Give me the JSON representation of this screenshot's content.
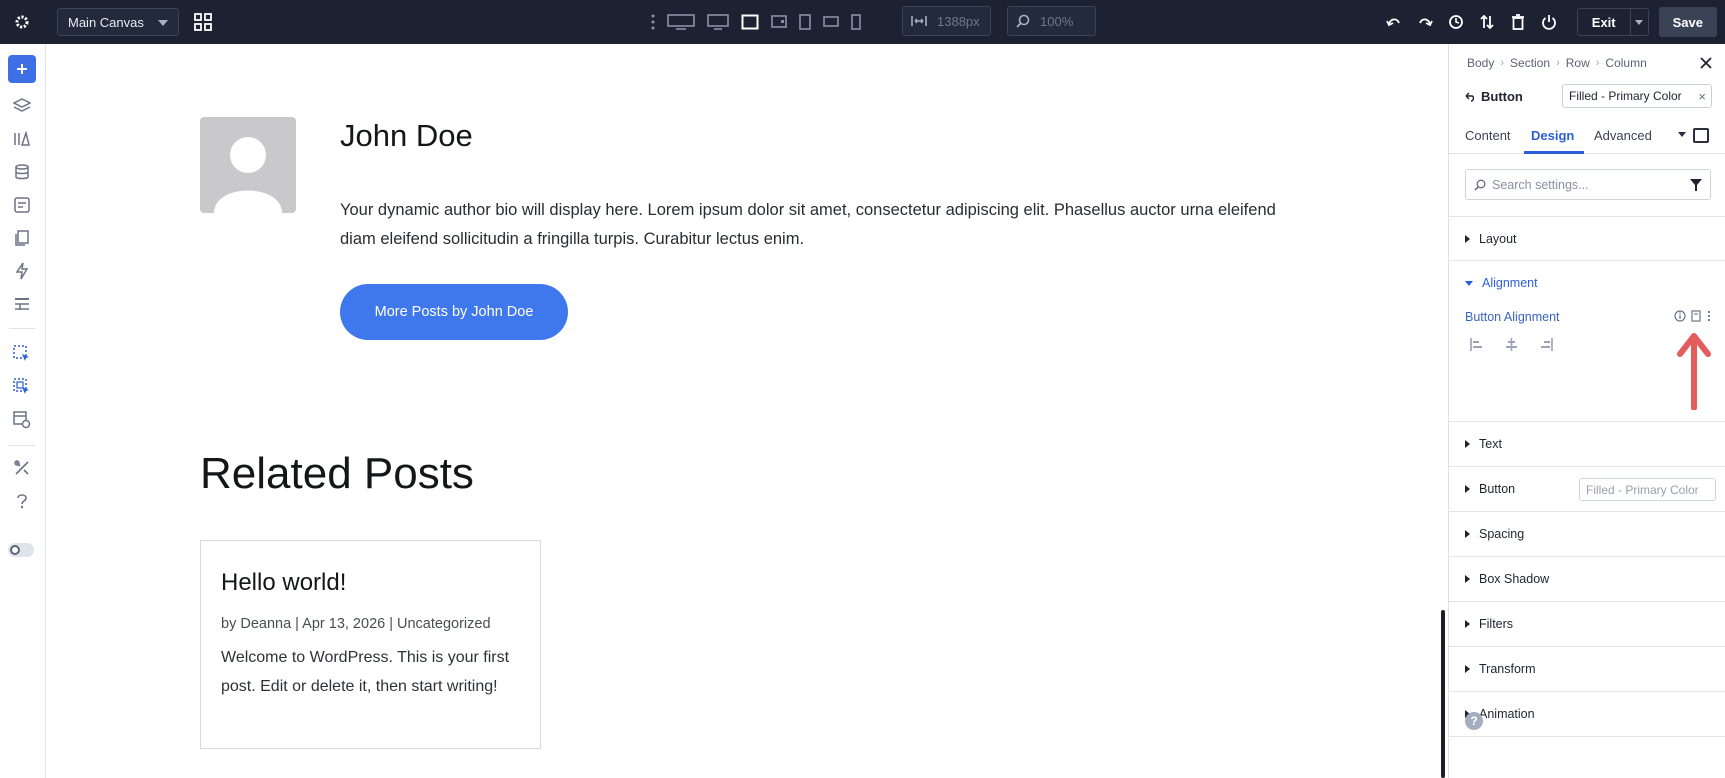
{
  "topbar": {
    "canvas_select": "Main Canvas",
    "width_value": "1388px",
    "zoom_value": "100%",
    "exit_label": "Exit",
    "save_label": "Save"
  },
  "canvas": {
    "author_name": "John Doe",
    "author_bio": "Your dynamic author bio will display here. Lorem ipsum dolor sit amet, consectetur adipiscing elit. Phasellus auctor urna eleifend diam eleifend sollicitudin a fringilla turpis. Curabitur lectus enim.",
    "more_posts_label": "More Posts by John Doe",
    "related_title": "Related Posts",
    "post": {
      "title": "Hello world!",
      "meta": "by Deanna | Apr 13, 2026 | Uncategorized",
      "excerpt": "Welcome to WordPress. This is your first post. Edit or delete it, then start writing!"
    }
  },
  "panel": {
    "breadcrumbs": [
      "Body",
      "Section",
      "Row",
      "Column"
    ],
    "element_title": "Button",
    "preset_chip": "Filled - Primary Color",
    "tabs": [
      "Content",
      "Design",
      "Advanced"
    ],
    "active_tab": "Design",
    "search_placeholder": "Search settings...",
    "sections": {
      "layout": "Layout",
      "alignment": "Alignment",
      "button_alignment_label": "Button Alignment",
      "text": "Text",
      "button": "Button",
      "button_preset": "Filled - Primary Color",
      "spacing": "Spacing",
      "box_shadow": "Box Shadow",
      "filters": "Filters",
      "transform": "Transform",
      "animation": "Animation"
    },
    "help_label": "?"
  },
  "colors": {
    "topbar_bg": "#1c2232",
    "accent": "#2b5fd9",
    "button_bg": "#3f78ec",
    "annotation_arrow": "#e35d5d"
  }
}
